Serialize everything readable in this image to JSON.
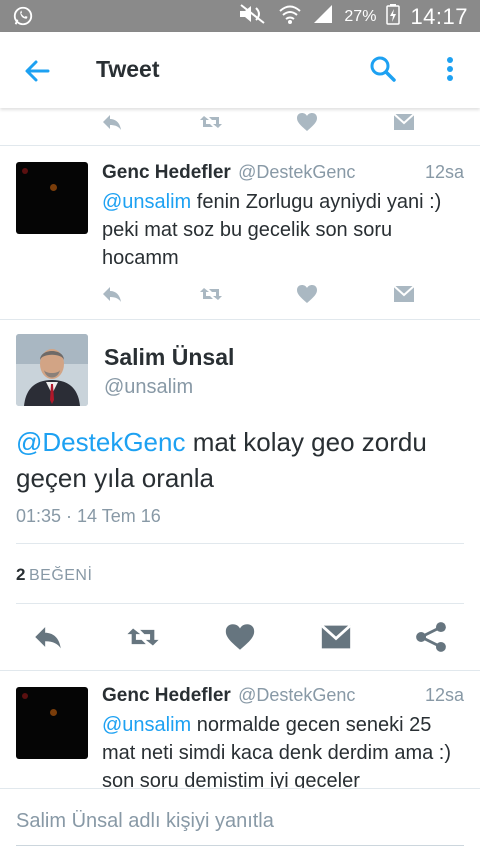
{
  "status_bar": {
    "battery_percent": "27%",
    "time": "14:17"
  },
  "app_bar": {
    "title": "Tweet"
  },
  "tweets": [
    {
      "name": "Genc Hedefler",
      "handle": "@DestekGenc",
      "time": "12sa",
      "mention": "@unsalim",
      "text": " fenin Zorlugu ayniydi yani :) peki mat soz bu gecelik son soru hocamm"
    },
    {
      "name": "Genc Hedefler",
      "handle": "@DestekGenc",
      "time": "12sa",
      "mention": "@unsalim",
      "text": " normalde gecen seneki 25 mat neti simdi kaca denk derdim ama :) son soru demistim iyi geceler"
    }
  ],
  "main_tweet": {
    "name": "Salim Ünsal",
    "handle": "@unsalim",
    "mention": "@DestekGenc",
    "text": " mat kolay geo zordu geçen yıla oranla",
    "date": "01:35 · 14 Tem 16",
    "likes_count": "2",
    "likes_label": "BEĞENİ"
  },
  "reply": {
    "placeholder": "Salim Ünsal adlı kişiyi yanıtla"
  },
  "colors": {
    "accent": "#1da1f2",
    "icon_gray": "#aab8c2",
    "action_dark": "#66757f",
    "status_bar": "#8a8a8a"
  }
}
